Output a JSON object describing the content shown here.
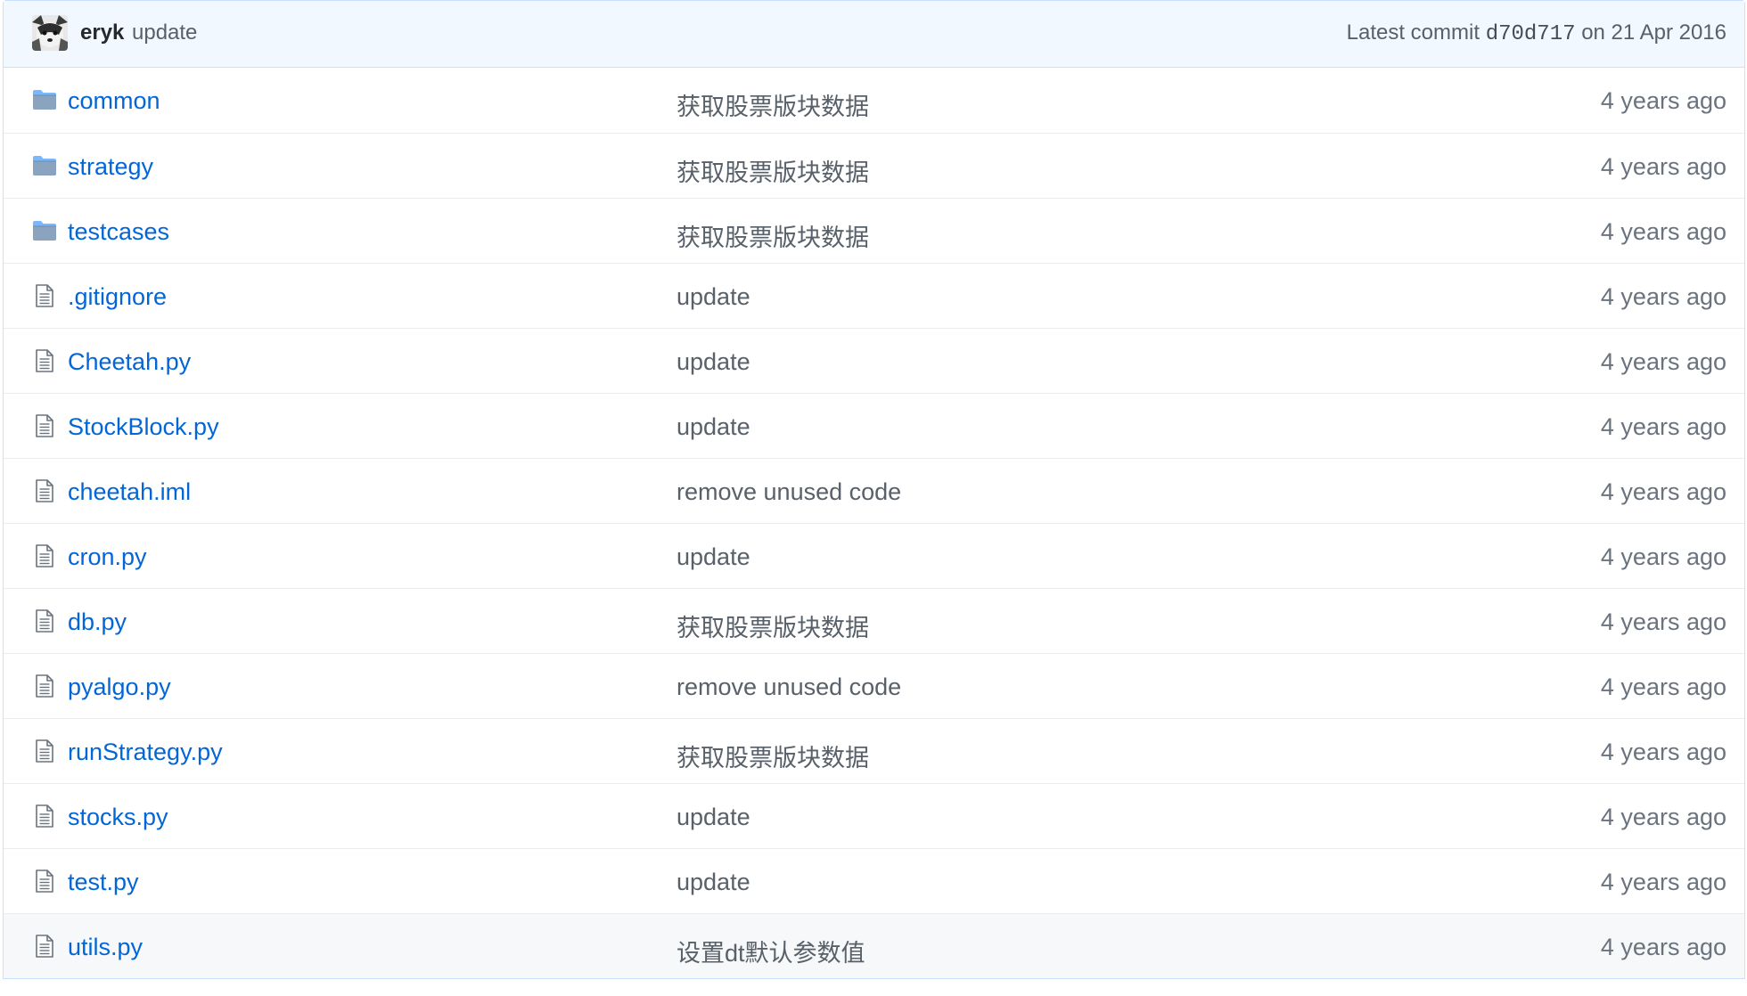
{
  "commit": {
    "author": "eryk",
    "message": "update",
    "meta_prefix": "Latest commit",
    "sha": "d70d717",
    "meta_suffix": "on 21 Apr 2016"
  },
  "colors": {
    "link": "#0366d6",
    "header_bg": "#f1f8ff",
    "folder_icon": "#79b8ff"
  },
  "files": [
    {
      "type": "folder",
      "icon": "folder-icon",
      "name": "common",
      "message": "获取股票版块数据",
      "age": "4 years ago"
    },
    {
      "type": "folder",
      "icon": "folder-icon",
      "name": "strategy",
      "message": "获取股票版块数据",
      "age": "4 years ago"
    },
    {
      "type": "folder",
      "icon": "folder-icon",
      "name": "testcases",
      "message": "获取股票版块数据",
      "age": "4 years ago"
    },
    {
      "type": "file",
      "icon": "file-icon",
      "name": ".gitignore",
      "message": "update",
      "age": "4 years ago"
    },
    {
      "type": "file",
      "icon": "file-icon",
      "name": "Cheetah.py",
      "message": "update",
      "age": "4 years ago"
    },
    {
      "type": "file",
      "icon": "file-icon",
      "name": "StockBlock.py",
      "message": "update",
      "age": "4 years ago"
    },
    {
      "type": "file",
      "icon": "file-icon",
      "name": "cheetah.iml",
      "message": "remove unused code",
      "age": "4 years ago"
    },
    {
      "type": "file",
      "icon": "file-icon",
      "name": "cron.py",
      "message": "update",
      "age": "4 years ago"
    },
    {
      "type": "file",
      "icon": "file-icon",
      "name": "db.py",
      "message": "获取股票版块数据",
      "age": "4 years ago"
    },
    {
      "type": "file",
      "icon": "file-icon",
      "name": "pyalgo.py",
      "message": "remove unused code",
      "age": "4 years ago"
    },
    {
      "type": "file",
      "icon": "file-icon",
      "name": "runStrategy.py",
      "message": "获取股票版块数据",
      "age": "4 years ago"
    },
    {
      "type": "file",
      "icon": "file-icon",
      "name": "stocks.py",
      "message": "update",
      "age": "4 years ago"
    },
    {
      "type": "file",
      "icon": "file-icon",
      "name": "test.py",
      "message": "update",
      "age": "4 years ago"
    },
    {
      "type": "file",
      "icon": "file-icon",
      "name": "utils.py",
      "message": "设置dt默认参数值",
      "age": "4 years ago"
    }
  ]
}
